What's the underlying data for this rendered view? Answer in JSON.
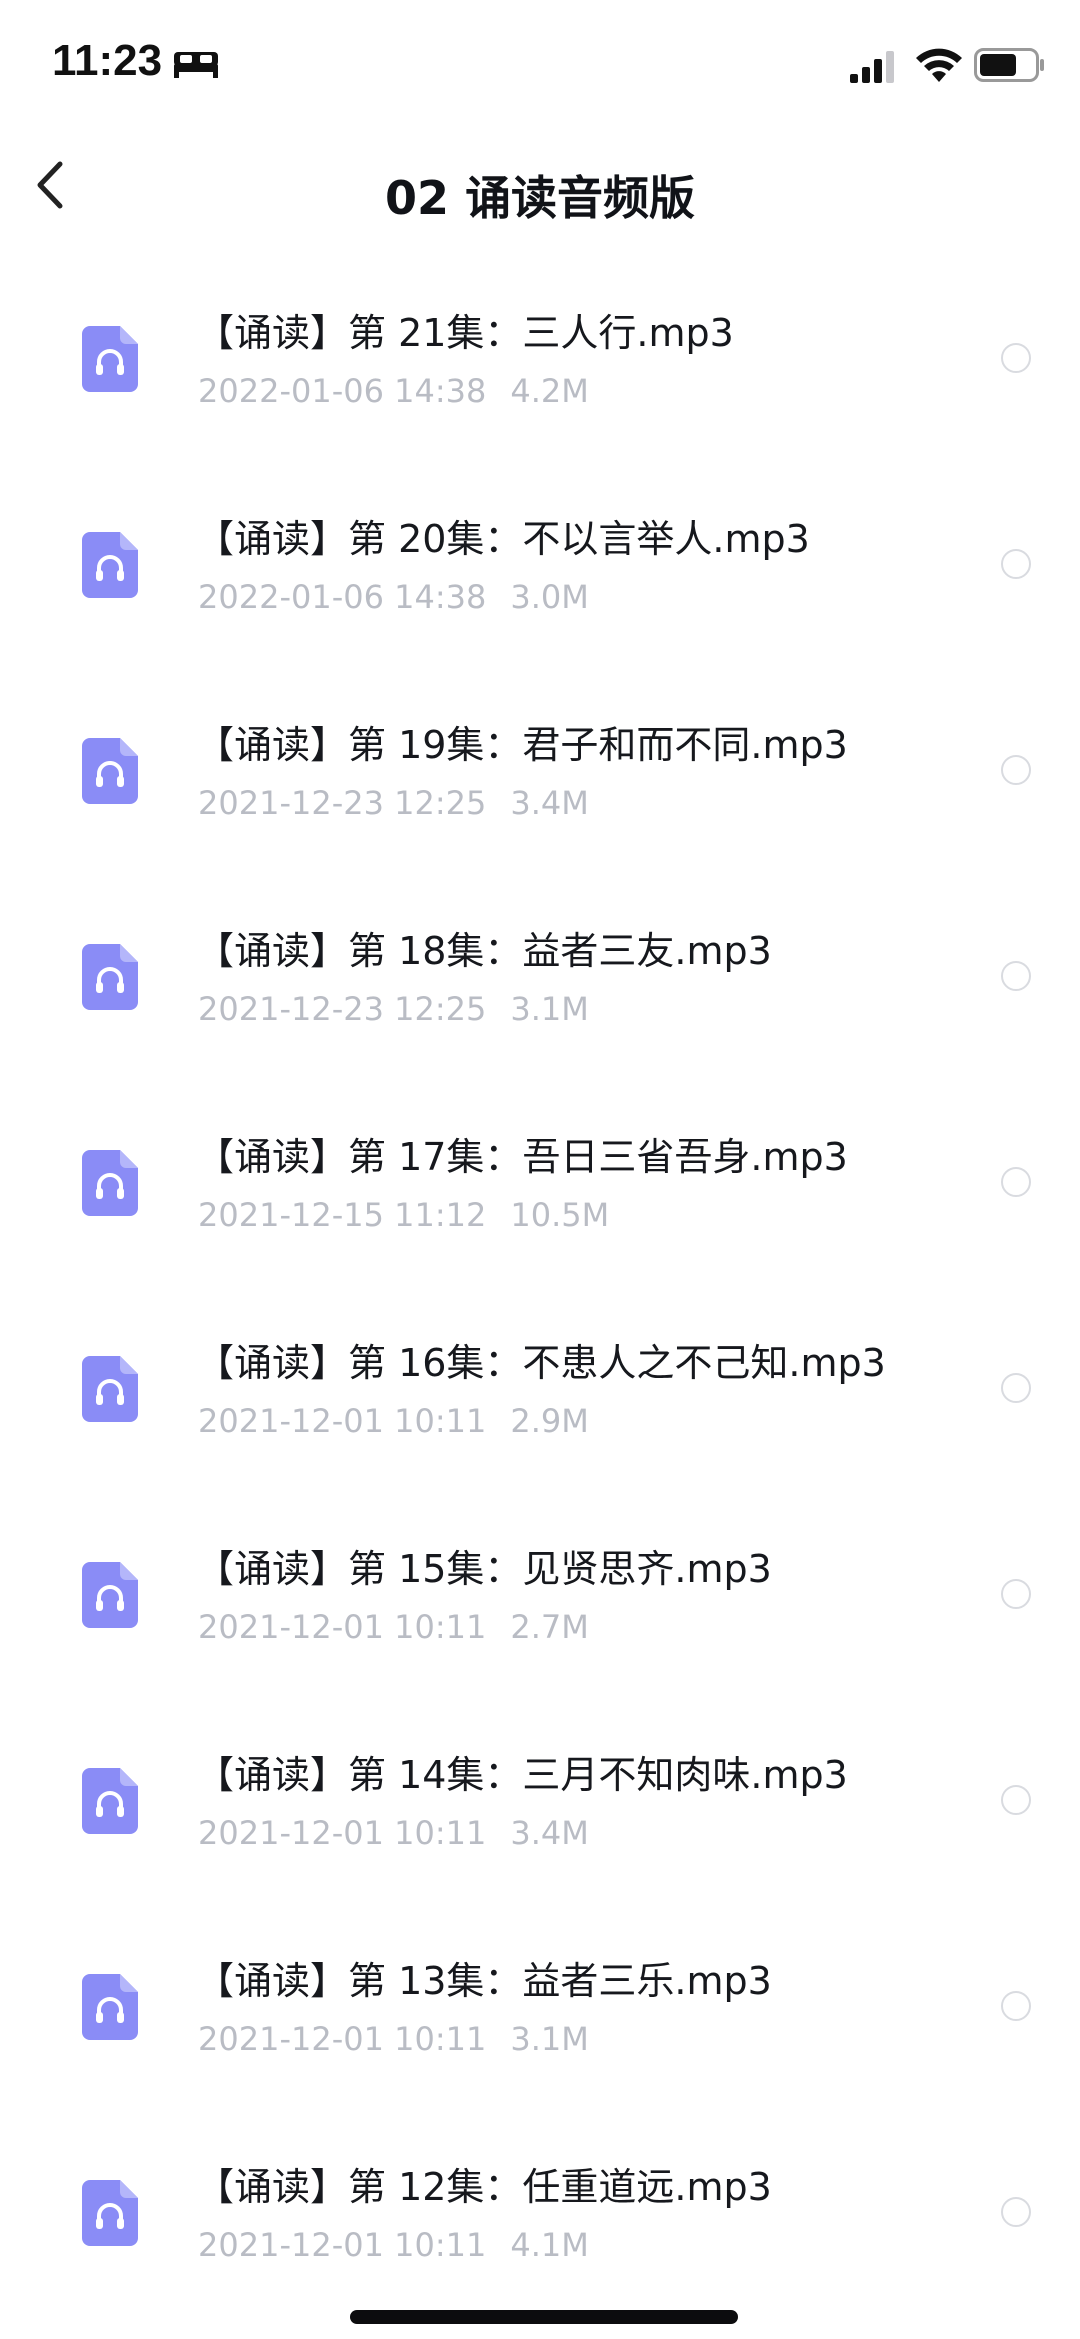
{
  "status_bar": {
    "time": "11:23",
    "icons": [
      "bed-icon",
      "signal-icon",
      "wifi-icon",
      "battery-icon"
    ]
  },
  "nav": {
    "title": "02 诵读音频版",
    "back_icon": "chevron-left-icon"
  },
  "colors": {
    "accent": "#8a8cf6",
    "meta_text": "#b9bcc4",
    "radio_border": "#d9dbe0"
  },
  "files": [
    {
      "name": "【诵读】第 21集：三人行.mp3",
      "date": "2022-01-06 14:38",
      "size": "4.2M"
    },
    {
      "name": "【诵读】第 20集：不以言举人.mp3",
      "date": "2022-01-06 14:38",
      "size": "3.0M"
    },
    {
      "name": "【诵读】第 19集：君子和而不同.mp3",
      "date": "2021-12-23 12:25",
      "size": "3.4M"
    },
    {
      "name": "【诵读】第 18集：益者三友.mp3",
      "date": "2021-12-23 12:25",
      "size": "3.1M"
    },
    {
      "name": "【诵读】第 17集：吾日三省吾身.mp3",
      "date": "2021-12-15 11:12",
      "size": "10.5M"
    },
    {
      "name": "【诵读】第 16集：不患人之不己知.mp3",
      "date": "2021-12-01 10:11",
      "size": "2.9M"
    },
    {
      "name": "【诵读】第 15集：见贤思齐.mp3",
      "date": "2021-12-01 10:11",
      "size": "2.7M"
    },
    {
      "name": "【诵读】第 14集：三月不知肉味.mp3",
      "date": "2021-12-01 10:11",
      "size": "3.4M"
    },
    {
      "name": "【诵读】第 13集：益者三乐.mp3",
      "date": "2021-12-01 10:11",
      "size": "3.1M"
    },
    {
      "name": "【诵读】第 12集：任重道远.mp3",
      "date": "2021-12-01 10:11",
      "size": "4.1M"
    }
  ]
}
